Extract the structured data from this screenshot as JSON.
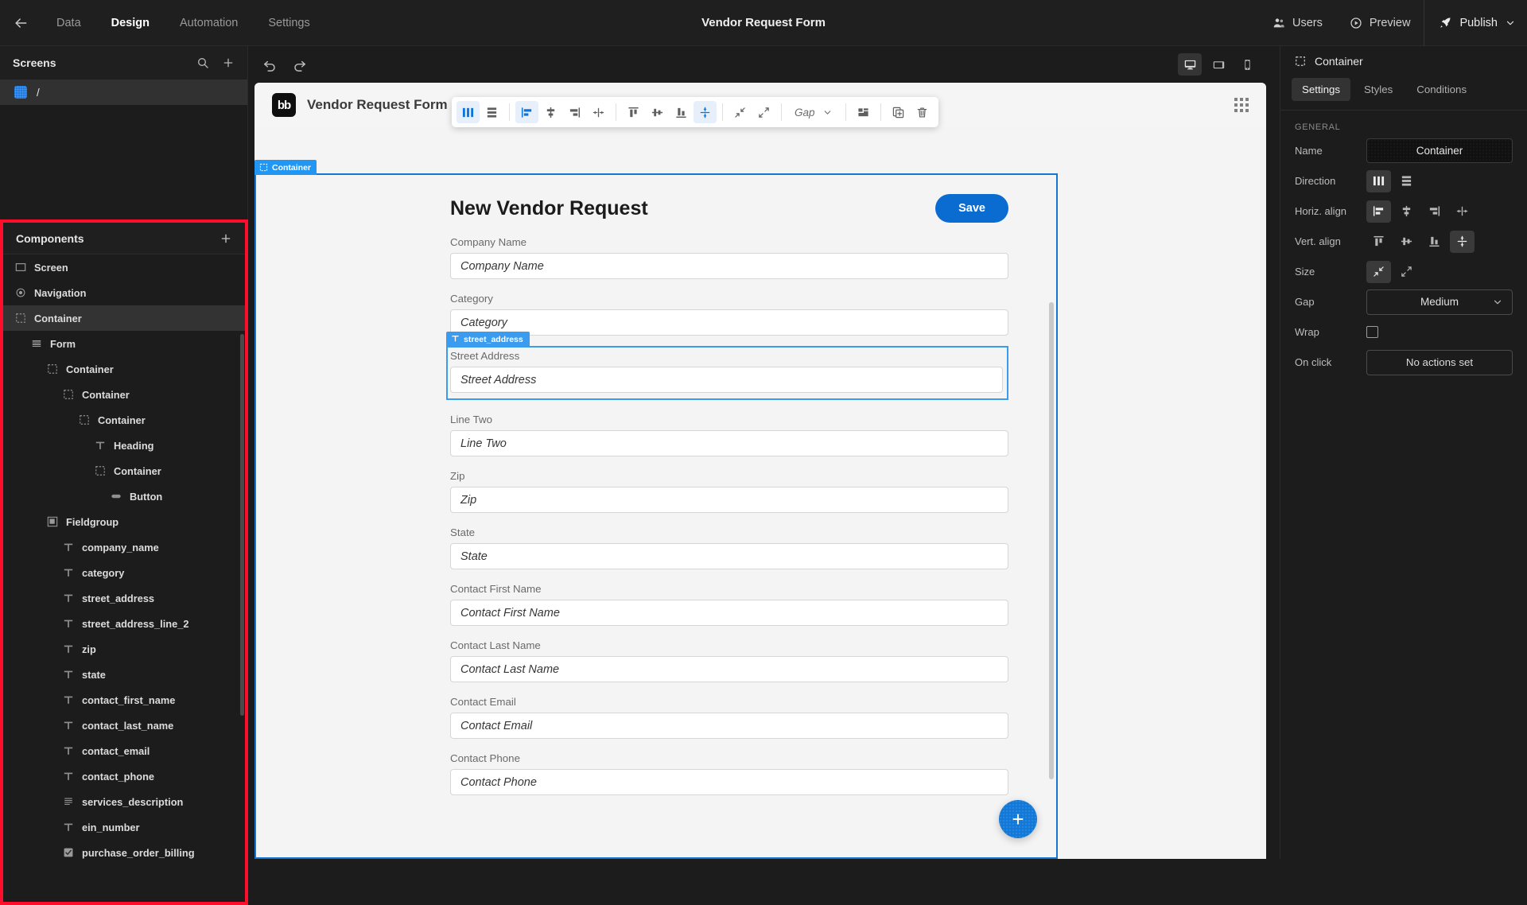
{
  "topbar": {
    "back_icon": "arrow-left-icon",
    "nav": [
      {
        "label": "Data",
        "active": false
      },
      {
        "label": "Design",
        "active": true
      },
      {
        "label": "Automation",
        "active": false
      },
      {
        "label": "Settings",
        "active": false
      }
    ],
    "app_title": "Vendor Request Form",
    "users_label": "Users",
    "preview_label": "Preview",
    "publish_label": "Publish"
  },
  "left": {
    "screens_title": "Screens",
    "screen_items": [
      {
        "label": "/"
      }
    ],
    "components_title": "Components",
    "tree": [
      {
        "label": "Screen",
        "depth": 0,
        "icon": "screen-icon",
        "selected": false
      },
      {
        "label": "Navigation",
        "depth": 0,
        "icon": "eye-icon",
        "selected": false
      },
      {
        "label": "Container",
        "depth": 0,
        "icon": "container-icon",
        "selected": true
      },
      {
        "label": "Form",
        "depth": 1,
        "icon": "form-icon",
        "selected": false
      },
      {
        "label": "Container",
        "depth": 2,
        "icon": "container-icon",
        "selected": false
      },
      {
        "label": "Container",
        "depth": 3,
        "icon": "container-icon",
        "selected": false
      },
      {
        "label": "Container",
        "depth": 4,
        "icon": "container-icon",
        "selected": false
      },
      {
        "label": "Heading",
        "depth": 5,
        "icon": "text-icon",
        "selected": false
      },
      {
        "label": "Container",
        "depth": 5,
        "icon": "container-icon",
        "selected": false
      },
      {
        "label": "Button",
        "depth": 6,
        "icon": "button-icon",
        "selected": false
      },
      {
        "label": "Fieldgroup",
        "depth": 2,
        "icon": "fieldgroup-icon",
        "selected": false
      },
      {
        "label": "company_name",
        "depth": 3,
        "icon": "text-icon",
        "selected": false
      },
      {
        "label": "category",
        "depth": 3,
        "icon": "text-icon",
        "selected": false
      },
      {
        "label": "street_address",
        "depth": 3,
        "icon": "text-icon",
        "selected": false
      },
      {
        "label": "street_address_line_2",
        "depth": 3,
        "icon": "text-icon",
        "selected": false
      },
      {
        "label": "zip",
        "depth": 3,
        "icon": "text-icon",
        "selected": false
      },
      {
        "label": "state",
        "depth": 3,
        "icon": "text-icon",
        "selected": false
      },
      {
        "label": "contact_first_name",
        "depth": 3,
        "icon": "text-icon",
        "selected": false
      },
      {
        "label": "contact_last_name",
        "depth": 3,
        "icon": "text-icon",
        "selected": false
      },
      {
        "label": "contact_email",
        "depth": 3,
        "icon": "text-icon",
        "selected": false
      },
      {
        "label": "contact_phone",
        "depth": 3,
        "icon": "text-icon",
        "selected": false
      },
      {
        "label": "services_description",
        "depth": 3,
        "icon": "longform-icon",
        "selected": false
      },
      {
        "label": "ein_number",
        "depth": 3,
        "icon": "text-icon",
        "selected": false
      },
      {
        "label": "purchase_order_billing",
        "depth": 3,
        "icon": "checkbox-icon",
        "selected": false
      }
    ]
  },
  "canvas": {
    "undo_icon": "undo-icon",
    "redo_icon": "redo-icon",
    "devices": [
      {
        "name": "desktop-icon",
        "active": true
      },
      {
        "name": "tablet-icon",
        "active": false
      },
      {
        "name": "mobile-icon",
        "active": false
      }
    ],
    "preview_logo": "bb",
    "preview_title": "Vendor Request Form",
    "toolbar": {
      "items": [
        {
          "name": "direction-horizontal-icon",
          "on": true
        },
        {
          "name": "direction-vertical-icon",
          "on": false
        },
        {
          "name": "align-left-icon",
          "on": true
        },
        {
          "name": "align-center-horizontal-icon",
          "on": false
        },
        {
          "name": "align-right-icon",
          "on": false
        },
        {
          "name": "distribute-horizontal-icon",
          "on": false
        },
        {
          "name": "align-top-icon",
          "on": false
        },
        {
          "name": "align-middle-icon",
          "on": false
        },
        {
          "name": "align-bottom-icon",
          "on": false
        },
        {
          "name": "distribute-vertical-icon",
          "on": true
        },
        {
          "name": "shrink-icon",
          "on": false
        },
        {
          "name": "grow-icon",
          "on": false
        }
      ],
      "gap_label": "Gap",
      "layout_icon": "layout-icon",
      "duplicate_icon": "duplicate-icon",
      "delete_icon": "trash-icon"
    },
    "container_badge": "Container",
    "form": {
      "heading": "New Vendor Request",
      "save_label": "Save",
      "selected_field_badge": "street_address",
      "fields": [
        {
          "label": "Company Name",
          "placeholder": "Company Name",
          "selected": false
        },
        {
          "label": "Category",
          "placeholder": "Category",
          "selected": false
        },
        {
          "label": "Street Address",
          "placeholder": "Street Address",
          "selected": true
        },
        {
          "label": "Line Two",
          "placeholder": "Line Two",
          "selected": false
        },
        {
          "label": "Zip",
          "placeholder": "Zip",
          "selected": false
        },
        {
          "label": "State",
          "placeholder": "State",
          "selected": false
        },
        {
          "label": "Contact First Name",
          "placeholder": "Contact First Name",
          "selected": false
        },
        {
          "label": "Contact Last Name",
          "placeholder": "Contact Last Name",
          "selected": false
        },
        {
          "label": "Contact Email",
          "placeholder": "Contact Email",
          "selected": false
        },
        {
          "label": "Contact Phone",
          "placeholder": "Contact Phone",
          "selected": false
        }
      ]
    },
    "fab_label": "+"
  },
  "right": {
    "title": "Container",
    "tabs": [
      {
        "label": "Settings",
        "active": true
      },
      {
        "label": "Styles",
        "active": false
      },
      {
        "label": "Conditions",
        "active": false
      }
    ],
    "section_label": "GENERAL",
    "name_label": "Name",
    "name_value": "Container",
    "direction_label": "Direction",
    "horiz_align_label": "Horiz. align",
    "vert_align_label": "Vert. align",
    "size_label": "Size",
    "gap_label": "Gap",
    "gap_value": "Medium",
    "wrap_label": "Wrap",
    "onclick_label": "On click",
    "onclick_value": "No actions set"
  },
  "colors": {
    "accent_blue": "#0a6cd1",
    "select_blue": "#2196f3",
    "highlight_red": "#ff0d2a",
    "panel_dark": "#1c1c1c"
  }
}
